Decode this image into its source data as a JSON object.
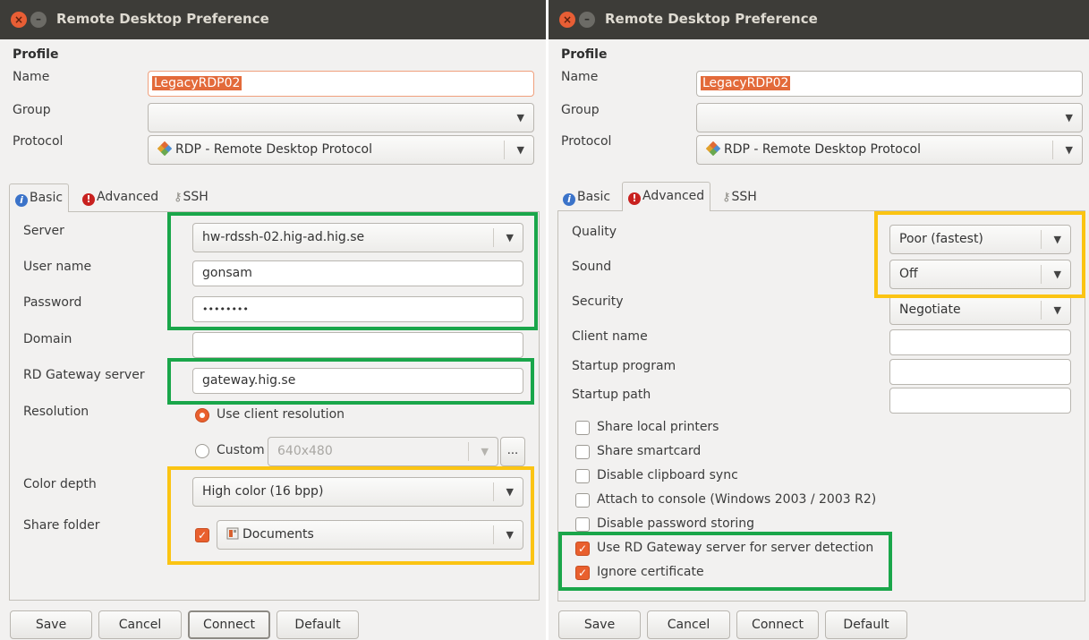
{
  "colors": {
    "accent_orange": "#e9602e",
    "highlight_green": "#1aa64a",
    "highlight_yellow": "#fbc413",
    "titlebar": "#3d3c38"
  },
  "window_title": "Remote Desktop Preference",
  "profile": {
    "heading": "Profile",
    "name_label": "Name",
    "name_value": "LegacyRDP02",
    "group_label": "Group",
    "group_value": "",
    "protocol_label": "Protocol",
    "protocol_value": "RDP - Remote Desktop Protocol"
  },
  "tabs": {
    "basic": "Basic",
    "advanced": "Advanced",
    "ssh": "SSH"
  },
  "basic": {
    "server_label": "Server",
    "server_value": "hw-rdssh-02.hig-ad.hig.se",
    "username_label": "User name",
    "username_value": "gonsam",
    "password_label": "Password",
    "password_value": "••••••••",
    "domain_label": "Domain",
    "domain_value": "",
    "gateway_label": "RD Gateway server",
    "gateway_value": "gateway.hig.se",
    "resolution_label": "Resolution",
    "use_client_resolution": "Use client resolution",
    "custom_label": "Custom",
    "custom_value": "640x480",
    "custom_more": "...",
    "color_depth_label": "Color depth",
    "color_depth_value": "High color (16 bpp)",
    "share_folder_label": "Share folder",
    "share_folder_value": "Documents"
  },
  "advanced": {
    "quality_label": "Quality",
    "quality_value": "Poor (fastest)",
    "sound_label": "Sound",
    "sound_value": "Off",
    "security_label": "Security",
    "security_value": "Negotiate",
    "client_name_label": "Client name",
    "startup_program_label": "Startup program",
    "startup_path_label": "Startup path",
    "checkboxes": [
      {
        "label": "Share local printers",
        "checked": false
      },
      {
        "label": "Share smartcard",
        "checked": false
      },
      {
        "label": "Disable clipboard sync",
        "checked": false
      },
      {
        "label": "Attach to console (Windows 2003 / 2003 R2)",
        "checked": false
      },
      {
        "label": "Disable password storing",
        "checked": false
      },
      {
        "label": "Use RD Gateway server for server detection",
        "checked": true
      },
      {
        "label": "Ignore certificate",
        "checked": true
      }
    ]
  },
  "buttons": {
    "save": "Save",
    "cancel": "Cancel",
    "connect": "Connect",
    "default": "Default"
  }
}
